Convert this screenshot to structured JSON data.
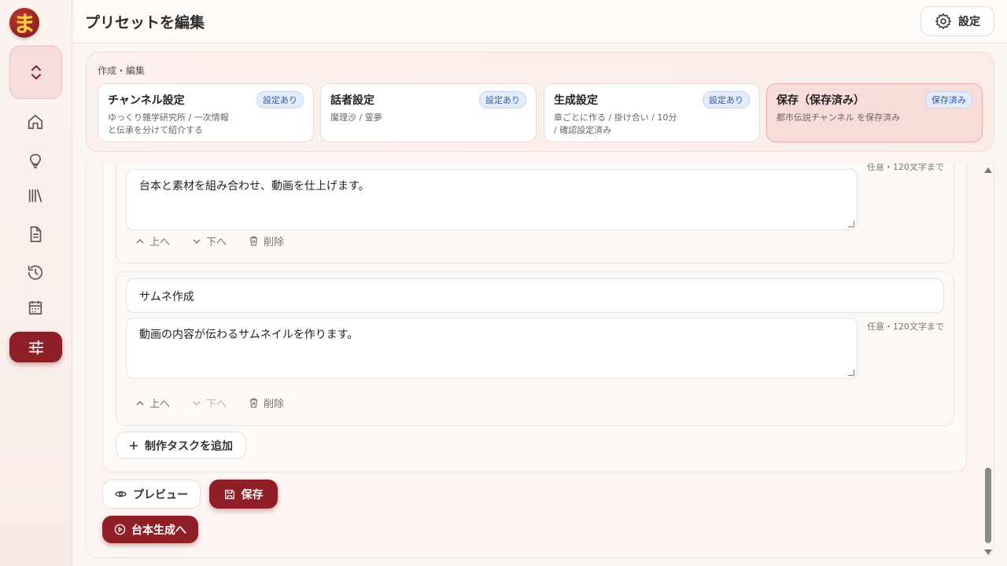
{
  "app": {
    "logo_char": "ま",
    "title": "プリセットを編集",
    "settings_label": "設定"
  },
  "sidebar": {
    "items": [
      {
        "name": "home-icon"
      },
      {
        "name": "lightbulb-icon"
      },
      {
        "name": "library-icon"
      },
      {
        "name": "document-icon"
      },
      {
        "name": "history-icon"
      },
      {
        "name": "calendar-icon"
      },
      {
        "name": "sliders-icon",
        "active": true
      }
    ]
  },
  "steps": {
    "label": "作成・編集",
    "cards": [
      {
        "title": "チャンネル設定",
        "badge": "設定あり",
        "desc1": "ゆっくり雑学研究所 / 一次情報",
        "desc2": "と伝承を分けて紹介する"
      },
      {
        "title": "話者設定",
        "badge": "設定あり",
        "desc1": "魔理沙 / 霊夢",
        "desc2": ""
      },
      {
        "title": "生成設定",
        "badge": "設定あり",
        "desc1": "章ごとに作る / 掛け合い / 10分",
        "desc2": "/ 確認設定済み"
      },
      {
        "title": "保存（保存済み）",
        "badge": "保存済み",
        "desc1": "都市伝説チャンネル を保存済み",
        "desc2": ""
      }
    ]
  },
  "tasks": [
    {
      "name": "",
      "description": "台本と素材を組み合わせ、動画を仕上げます。",
      "hint": "任意・120文字まで",
      "up": "上へ",
      "down": "下へ",
      "delete": "削除"
    },
    {
      "name": "サムネ作成",
      "description": "動画の内容が伝わるサムネイルを作ります。",
      "hint": "任意・120文字まで",
      "up": "上へ",
      "down": "下へ",
      "delete": "削除"
    }
  ],
  "buttons": {
    "add_task": "制作タスクを追加",
    "preview": "プレビュー",
    "save": "保存",
    "to_script": "台本生成へ"
  },
  "colors": {
    "accent": "#8e1f27",
    "badge_text": "#2f5aa8"
  }
}
